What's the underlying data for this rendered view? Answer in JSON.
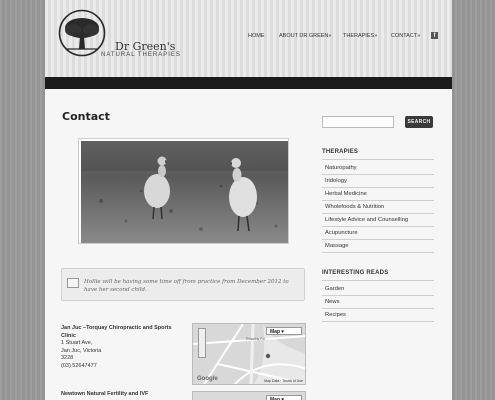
{
  "site": {
    "name": "Dr Green's",
    "tagline": "NATURAL THERAPIES"
  },
  "nav": {
    "items": [
      "HOME",
      "ABOUT DR GREEN",
      "THERAPIES",
      "CONTACT"
    ],
    "social": "f"
  },
  "page": {
    "title": "Contact"
  },
  "notice": {
    "text": "Hollie will be having some time off from practice from December 2012 to have her second child."
  },
  "clinics": [
    {
      "name": "Jan Juc –Torquay Chiropractic and Sports Clinic",
      "address1": "1 Stuart Ave,",
      "address2": "Jan Juc, Victoria",
      "postcode": "3228",
      "phone": "(03) 52647477"
    },
    {
      "name": "Newtown Natural Fertility and IVF"
    }
  ],
  "map": {
    "type_label": "Map",
    "google": "Google",
    "footer": "Map Data · Terms of Use",
    "street": "Ewanbly Rd"
  },
  "search": {
    "button_label": "SEARCH"
  },
  "sidebar": {
    "therapies_heading": "THERAPIES",
    "therapies": [
      "Naturopathy",
      "Iridology",
      "Herbal Medicine",
      "Wholefoods & Nutrition",
      "Lifestyle Advice and Counselling",
      "Acupuncture",
      "Massage"
    ],
    "reads_heading": "INTERESTING READS",
    "reads": [
      "Garden",
      "News",
      "Recipes"
    ]
  },
  "colors": {
    "dark_bar": "#1c1c1c",
    "button": "#3a3a3a"
  }
}
